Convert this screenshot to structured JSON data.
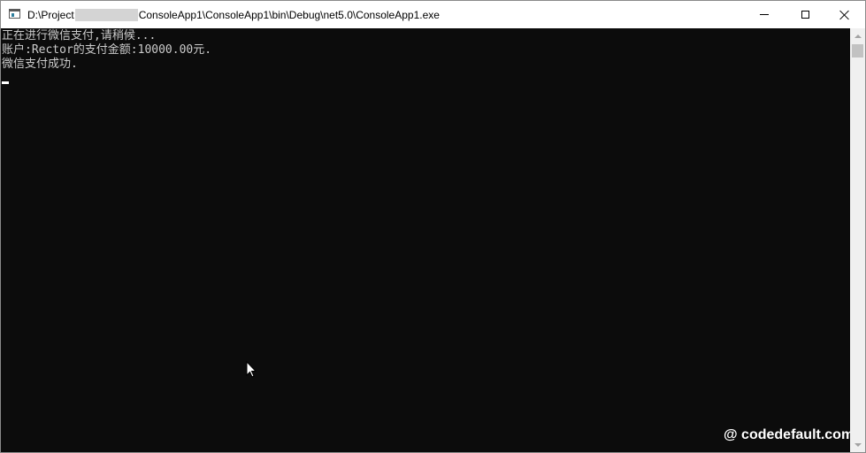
{
  "window": {
    "title_prefix": "D:\\Project",
    "title_suffix": "ConsoleApp1\\ConsoleApp1\\bin\\Debug\\net5.0\\ConsoleApp1.exe",
    "icon": "console-app-icon",
    "buttons": {
      "minimize": "minimize-icon",
      "maximize": "maximize-icon",
      "close": "close-icon"
    }
  },
  "console": {
    "background": "#0c0c0c",
    "foreground": "#cccccc",
    "lines": [
      "正在进行微信支付,请稍候...",
      "账户:Rector的支付金额:10000.00元.",
      "微信支付成功."
    ]
  },
  "watermark": "@ codedefault.com"
}
